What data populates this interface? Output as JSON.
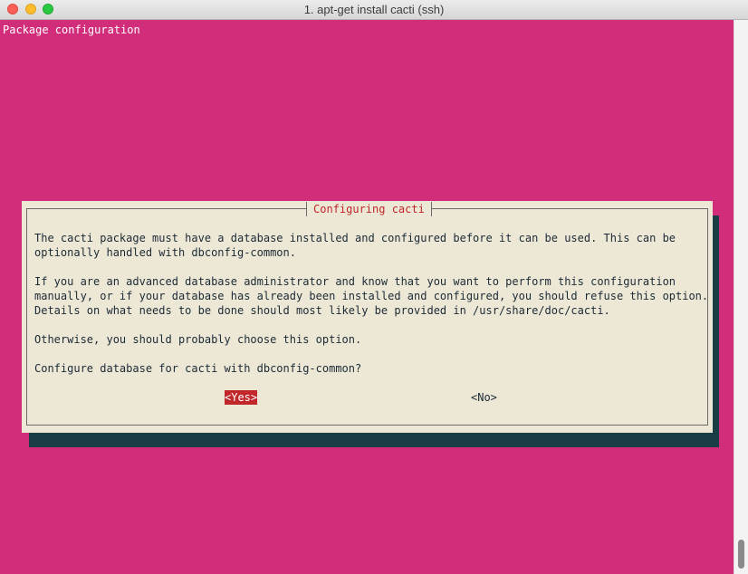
{
  "window": {
    "title": "1. apt-get install cacti (ssh)"
  },
  "backtitle": "Package configuration",
  "dialog": {
    "title": "Configuring cacti",
    "paragraphs": [
      "The cacti package must have a database installed and configured before it can be used. This can be\noptionally handled with dbconfig-common.",
      "If you are an advanced database administrator and know that you want to perform this configuration\nmanually, or if your database has already been installed and configured, you should refuse this option.\nDetails on what needs to be done should most likely be provided in /usr/share/doc/cacti.",
      "Otherwise, you should probably choose this option.",
      "Configure database for cacti with dbconfig-common?"
    ],
    "buttons": {
      "yes": "<Yes>",
      "no": "<No>"
    }
  },
  "colors": {
    "terminal_background": "#d22d7a",
    "dialog_background": "#ede8d6",
    "dialog_title": "#c0262a",
    "selected_button": "#c0262a",
    "shadow": "#1b3d44"
  }
}
